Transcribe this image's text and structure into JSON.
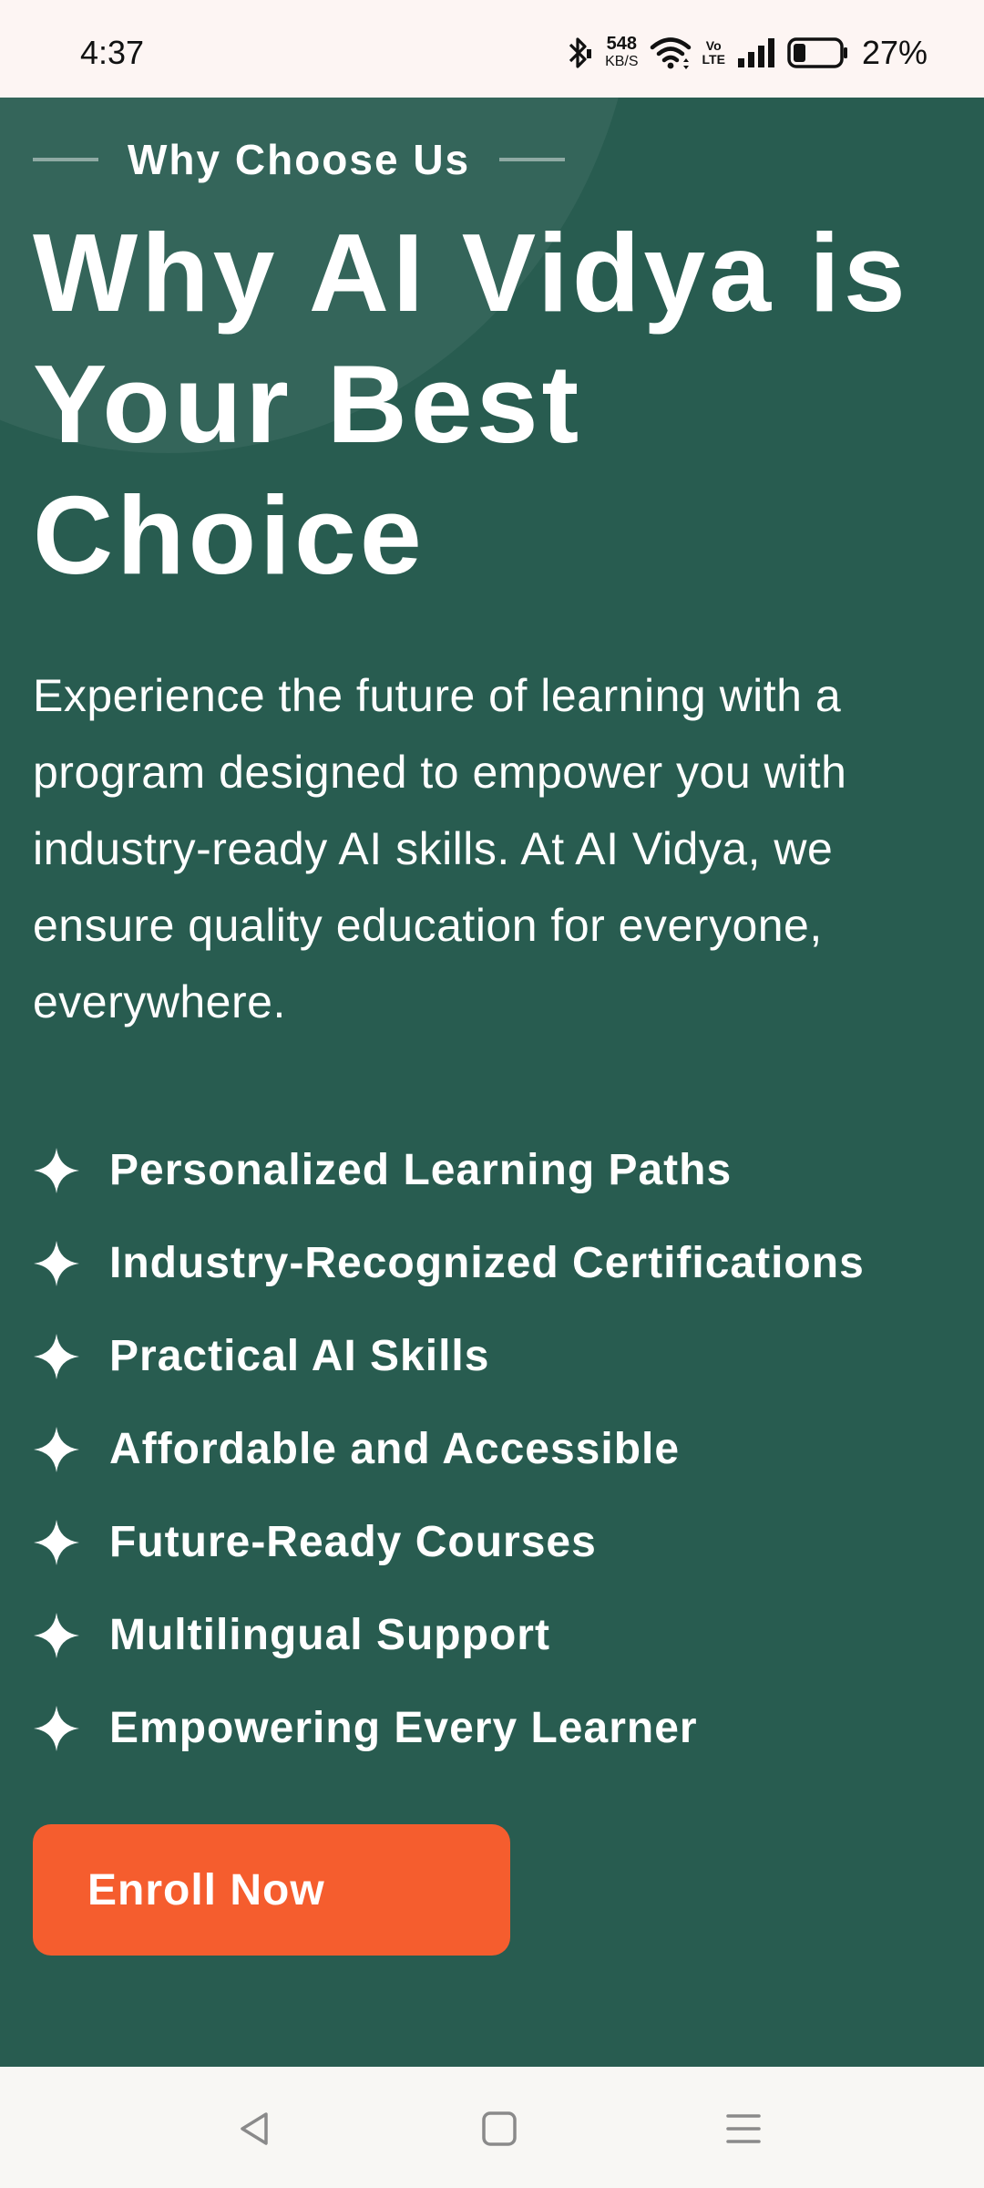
{
  "status_bar": {
    "time": "4:37",
    "net_speed_value": "548",
    "net_speed_unit": "KB/S",
    "volte_top": "Vo",
    "volte_bottom": "LTE",
    "battery_percent": "27%",
    "battery_level": 0.27,
    "icons": [
      "bluetooth-icon",
      "wifi-icon",
      "signal-icon",
      "battery-icon"
    ]
  },
  "section": {
    "eyebrow": "Why Choose Us",
    "headline": "Why AI Vidya is Your Best Choice",
    "description": "Experience the future of learning with a program designed to empower you with industry-ready AI skills. At AI Vidya, we ensure quality education for everyone, everywhere.",
    "features": [
      {
        "label": "Personalized Learning Paths",
        "icon": "sparkle-icon"
      },
      {
        "label": "Industry-Recognized Certifications",
        "icon": "sparkle-icon"
      },
      {
        "label": "Practical AI Skills",
        "icon": "sparkle-icon"
      },
      {
        "label": "Affordable and Accessible",
        "icon": "sparkle-icon"
      },
      {
        "label": "Future-Ready Courses",
        "icon": "sparkle-icon"
      },
      {
        "label": "Multilingual Support",
        "icon": "sparkle-icon"
      },
      {
        "label": "Empowering Every Learner",
        "icon": "sparkle-icon"
      }
    ],
    "cta_label": "Enroll Now"
  },
  "colors": {
    "background": "#285c50",
    "accent": "#f55d2e",
    "status_bar": "#fdf5f3",
    "nav_bar": "#f8f7f4"
  },
  "nav_bar": {
    "buttons": [
      "back-icon",
      "home-icon",
      "menu-icon"
    ]
  }
}
